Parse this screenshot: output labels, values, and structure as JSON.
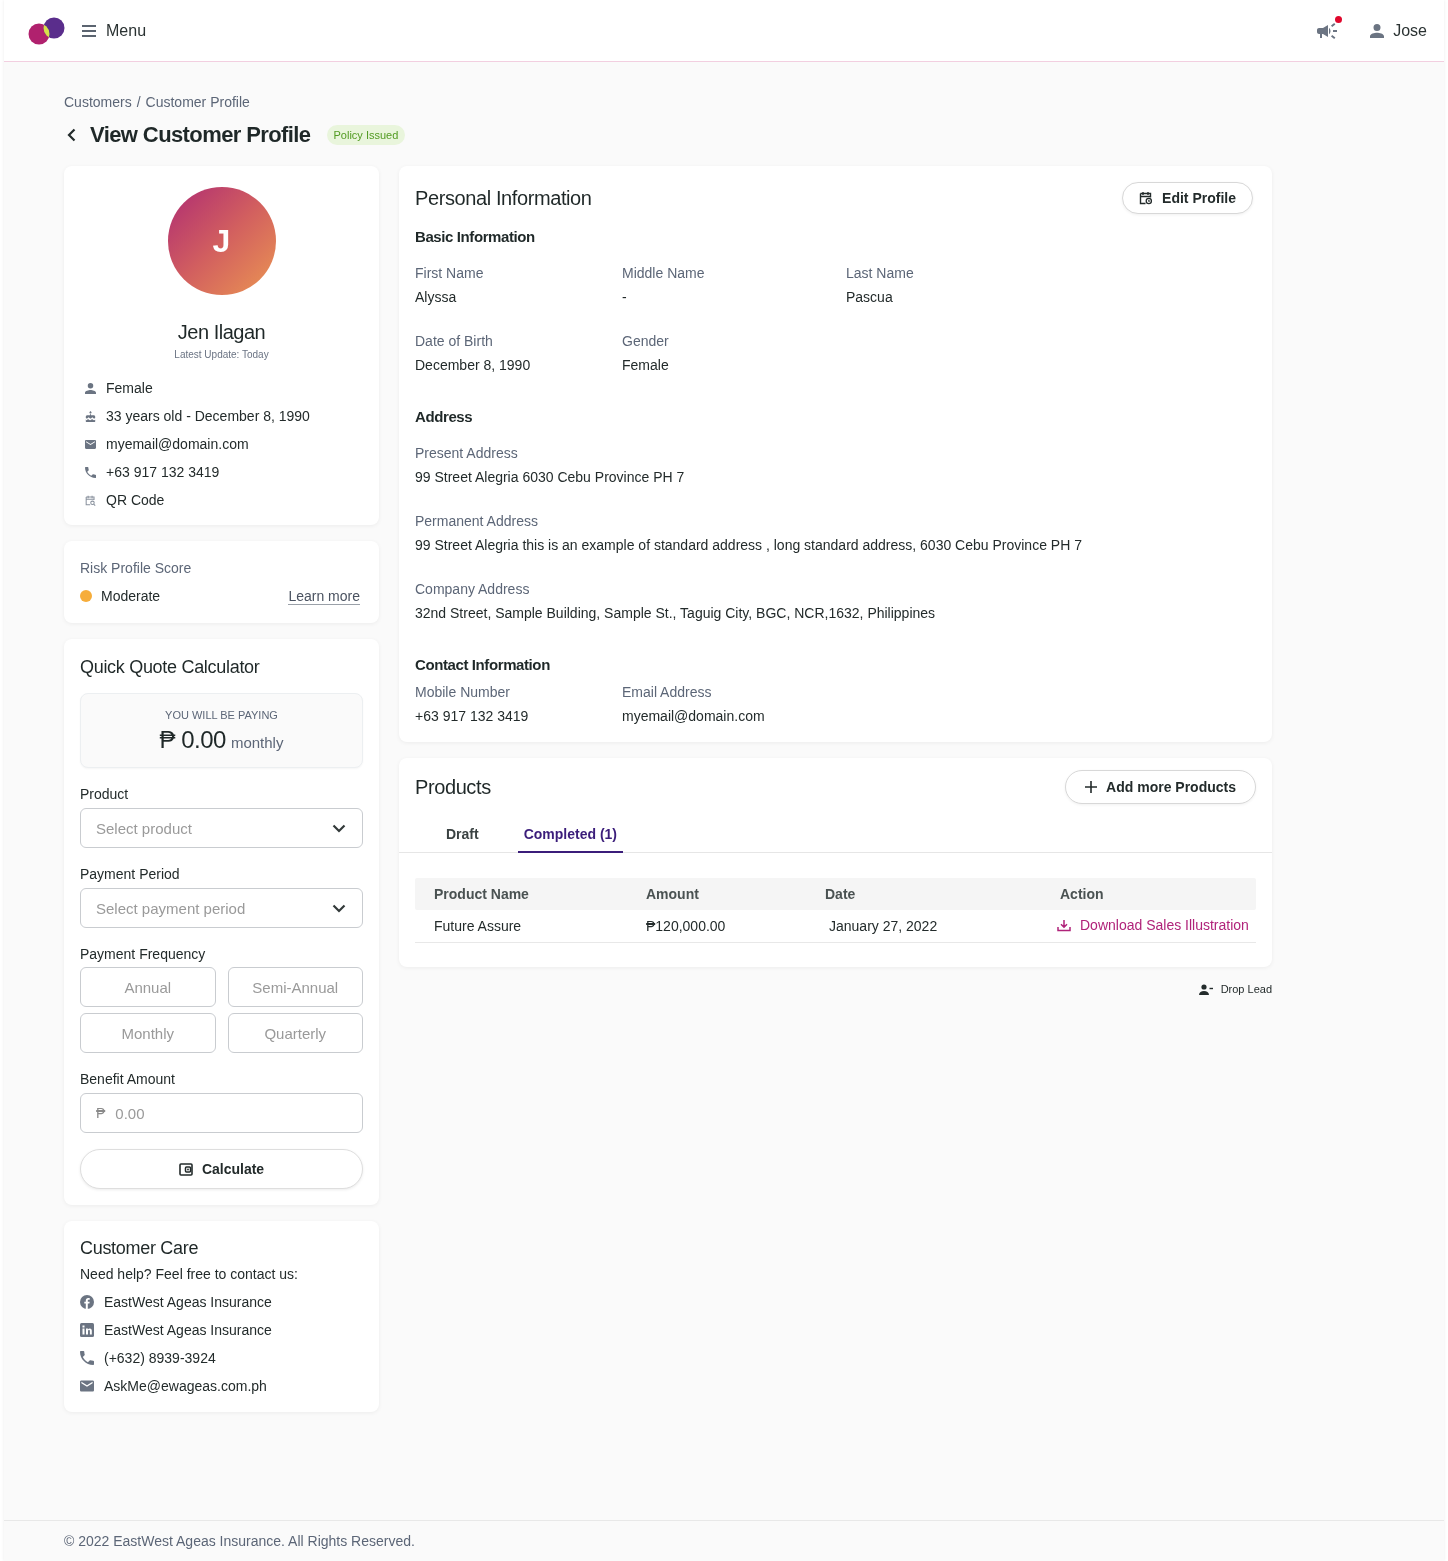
{
  "header": {
    "menu_label": "Menu",
    "unread_announcements": true,
    "user_name": "Jose"
  },
  "breadcrumb": {
    "items": [
      "Customers",
      "Customer Profile"
    ],
    "separator": "/"
  },
  "page_title": "View Customer Profile",
  "status_badge": "Policy Issued",
  "profile": {
    "initial": "J",
    "name": "Jen Ilagan",
    "latest_update": "Latest Update: Today",
    "details": [
      {
        "kind": "gender",
        "text": "Female"
      },
      {
        "kind": "birthday",
        "text": "33 years old - December 8, 1990"
      },
      {
        "kind": "email",
        "text": "myemail@domain.com"
      },
      {
        "kind": "phone",
        "text": "+63 917 132 3419"
      },
      {
        "kind": "qr",
        "text": "QR Code"
      }
    ]
  },
  "risk": {
    "label": "Risk Profile Score",
    "value": "Moderate",
    "color": "#f6ad3b",
    "link": "Learn more"
  },
  "quote": {
    "title": "Quick Quote Calculator",
    "summary": {
      "caption": "YOU WILL BE PAYING",
      "currency": "₱",
      "amount": "0.00",
      "period": "monthly"
    },
    "fields": [
      {
        "kind": "select",
        "label": "Product",
        "placeholder": "Select product"
      },
      {
        "kind": "select",
        "label": "Payment Period",
        "placeholder": "Select payment period"
      },
      {
        "kind": "options",
        "label": "Payment Frequency",
        "options": [
          {
            "label": "Annual",
            "selected": false
          },
          {
            "label": "Semi-Annual",
            "selected": false
          },
          {
            "label": "Monthly",
            "selected": false
          },
          {
            "label": "Quarterly",
            "selected": false
          }
        ]
      },
      {
        "kind": "amount",
        "label": "Benefit Amount",
        "prefix": "₱",
        "placeholder": "0.00"
      }
    ],
    "button": "Calculate"
  },
  "customer_care": {
    "title": "Customer Care",
    "intro": "Need help? Feel free to contact us:",
    "contacts": [
      {
        "kind": "facebook",
        "text": "EastWest Ageas Insurance"
      },
      {
        "kind": "linkedin",
        "text": "EastWest Ageas Insurance"
      },
      {
        "kind": "phone",
        "text": "(+632) 8939-3924"
      },
      {
        "kind": "email",
        "text": "AskMe@ewageas.com.ph"
      }
    ]
  },
  "personal_information": {
    "title": "Personal Information",
    "edit_button": "Edit Profile",
    "sections": [
      {
        "title": "Basic Information",
        "rows": [
          [
            {
              "label": "First Name",
              "value": "Alyssa"
            },
            {
              "label": "Middle Name",
              "value": "-"
            },
            {
              "label": "Last Name",
              "value": "Pascua"
            }
          ],
          [
            {
              "label": "Date of Birth",
              "value": "December 8, 1990"
            },
            {
              "label": "Gender",
              "value": "Female"
            }
          ]
        ]
      },
      {
        "title": "Address",
        "rows": [
          [
            {
              "label": "Present Address",
              "value": "99 Street Alegria 6030 Cebu Province PH 7"
            }
          ],
          [
            {
              "label": "Permanent Address",
              "value": "99 Street Alegria this is an example of standard address , long standard address, 6030 Cebu Province PH 7"
            }
          ],
          [
            {
              "label": "Company Address",
              "value": "32nd Street, Sample Building, Sample St., Taguig City, BGC, NCR,1632, Philippines"
            }
          ]
        ]
      },
      {
        "title": "Contact Information",
        "rows": [
          [
            {
              "label": "Mobile Number",
              "value": "+63 917 132 3419"
            },
            {
              "label": "Email Address",
              "value": "myemail@domain.com"
            }
          ]
        ]
      }
    ]
  },
  "products": {
    "title": "Products",
    "add_button": "Add more Products",
    "tabs": [
      {
        "label": "Draft",
        "selected": false
      },
      {
        "label": "Completed (1)",
        "selected": true
      }
    ],
    "table": {
      "columns": [
        {
          "label": "Product Name",
          "kind": "text"
        },
        {
          "label": "Amount",
          "kind": "text"
        },
        {
          "label": "Date",
          "kind": "text"
        },
        {
          "label": "Action",
          "kind": "download"
        }
      ],
      "rows": [
        [
          "Future Assure",
          "₱120,000.00",
          "January 27, 2022",
          "Download Sales Illustration"
        ]
      ]
    }
  },
  "drop_lead": "Drop Lead",
  "footer": "© 2022 EastWest Ageas Insurance. All Rights Reserved."
}
